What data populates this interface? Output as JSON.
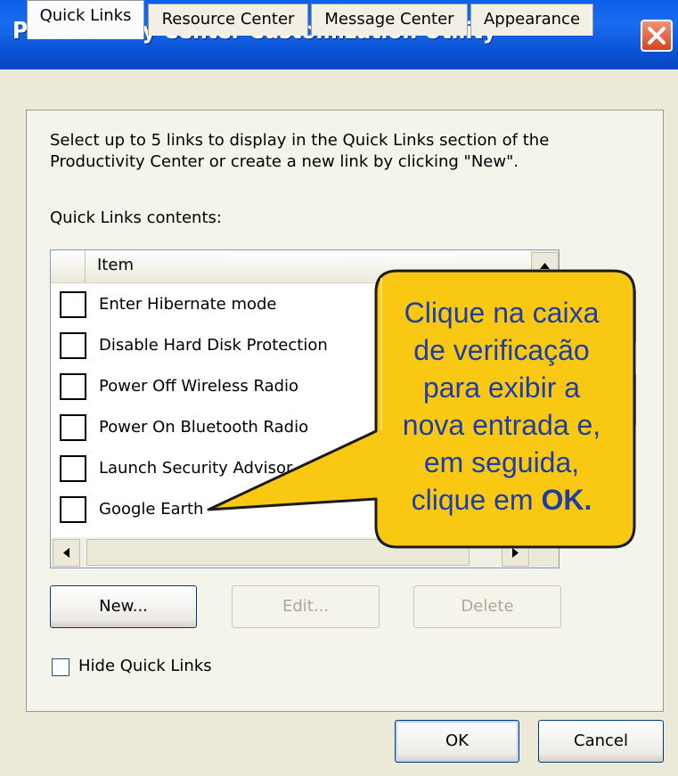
{
  "window": {
    "title": "Productivity Center Customization Utility"
  },
  "tabs": [
    {
      "label": "Quick Links",
      "active": true
    },
    {
      "label": "Resource Center",
      "active": false
    },
    {
      "label": "Message Center",
      "active": false
    },
    {
      "label": "Appearance",
      "active": false
    }
  ],
  "quick_links": {
    "description_line1": "Select up to 5 links to display in the Quick Links section of the",
    "description_line2": "Productivity Center or create a new link by clicking \"New\".",
    "contents_label": "Quick Links contents:",
    "column_header": "Item",
    "items": [
      {
        "label": "Enter Hibernate mode",
        "checked": false
      },
      {
        "label": "Disable Hard Disk Protection",
        "checked": false
      },
      {
        "label": "Power Off Wireless Radio",
        "checked": false
      },
      {
        "label": "Power On Bluetooth Radio",
        "checked": false
      },
      {
        "label": "Launch Security Advisor",
        "checked": false
      },
      {
        "label": "Google Earth",
        "checked": false
      }
    ],
    "buttons": {
      "new": "New...",
      "edit": "Edit...",
      "delete": "Delete"
    },
    "hide_label": "Hide Quick Links",
    "hide_checked": false
  },
  "footer": {
    "ok": "OK",
    "cancel": "Cancel"
  },
  "callout": {
    "line1": "Clique na caixa",
    "line2": "de verificação",
    "line3": "para exibir a",
    "line4": "nova entrada e,",
    "line5": "em seguida,",
    "line6_prefix": "clique em ",
    "line6_bold": "OK."
  },
  "colors": {
    "titlebar": "#0A5FE8",
    "callout_fill": "#F9C813",
    "callout_text": "#1F3FA0",
    "close_button": "#D8431A"
  }
}
